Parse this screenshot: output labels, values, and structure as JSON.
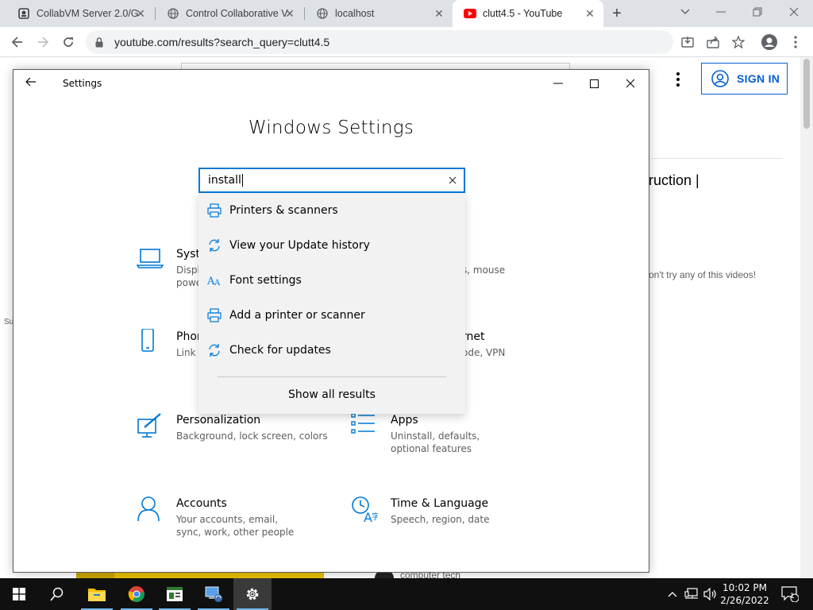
{
  "browser": {
    "tabs": [
      {
        "title": "CollabVM Server 2.0/G",
        "icon": "collabvm-icon",
        "active": false
      },
      {
        "title": "Control Collaborative V",
        "icon": "globe-icon",
        "active": false
      },
      {
        "title": "localhost",
        "icon": "globe-icon",
        "active": false
      },
      {
        "title": "clutt4.5 - YouTube",
        "icon": "youtube-icon",
        "active": true
      }
    ],
    "url": "youtube.com/results?search_query=clutt4.5"
  },
  "youtube": {
    "sign_in": "SIGN IN",
    "video_title_fragment": "ruction |",
    "video_desc_fragment": "on't try any of this videos!",
    "side_fragment": "Su",
    "channel_fragment": "computer tech"
  },
  "settings": {
    "window_title": "Settings",
    "heading": "Windows Settings",
    "search": {
      "value": "install"
    },
    "results": [
      {
        "label": "Printers & scanners",
        "icon": "printer-icon"
      },
      {
        "label": "View your Update history",
        "icon": "refresh-icon"
      },
      {
        "label": "Font settings",
        "icon": "font-icon"
      },
      {
        "label": "Add a printer or scanner",
        "icon": "printer-icon"
      },
      {
        "label": "Check for updates",
        "icon": "refresh-icon"
      }
    ],
    "show_all": "Show all results",
    "categories": {
      "system": {
        "name": "Syste",
        "desc": "Displ\npowe"
      },
      "devices_partial": {
        "desc": "s, mouse"
      },
      "phone": {
        "name": "Phon",
        "desc": "Link y"
      },
      "network_partial": {
        "name": "rnet",
        "desc": "ode, VPN"
      },
      "personalization": {
        "name": "Personalization",
        "desc": "Background, lock screen, colors"
      },
      "apps": {
        "name": "Apps",
        "desc": "Uninstall, defaults, optional features"
      },
      "accounts": {
        "name": "Accounts",
        "desc": "Your accounts, email, sync, work, other people"
      },
      "time": {
        "name": "Time & Language",
        "desc": "Speech, region, date"
      }
    }
  },
  "taskbar": {
    "items": [
      "start",
      "search",
      "file-explorer",
      "chrome",
      "app-window",
      "network-app",
      "settings"
    ],
    "time": "10:02 PM",
    "date": "2/26/2022",
    "notifications": "1"
  },
  "colors": {
    "accent": "#0078d7",
    "youtube_blue": "#065fd4",
    "youtube_red": "#ff0000"
  }
}
